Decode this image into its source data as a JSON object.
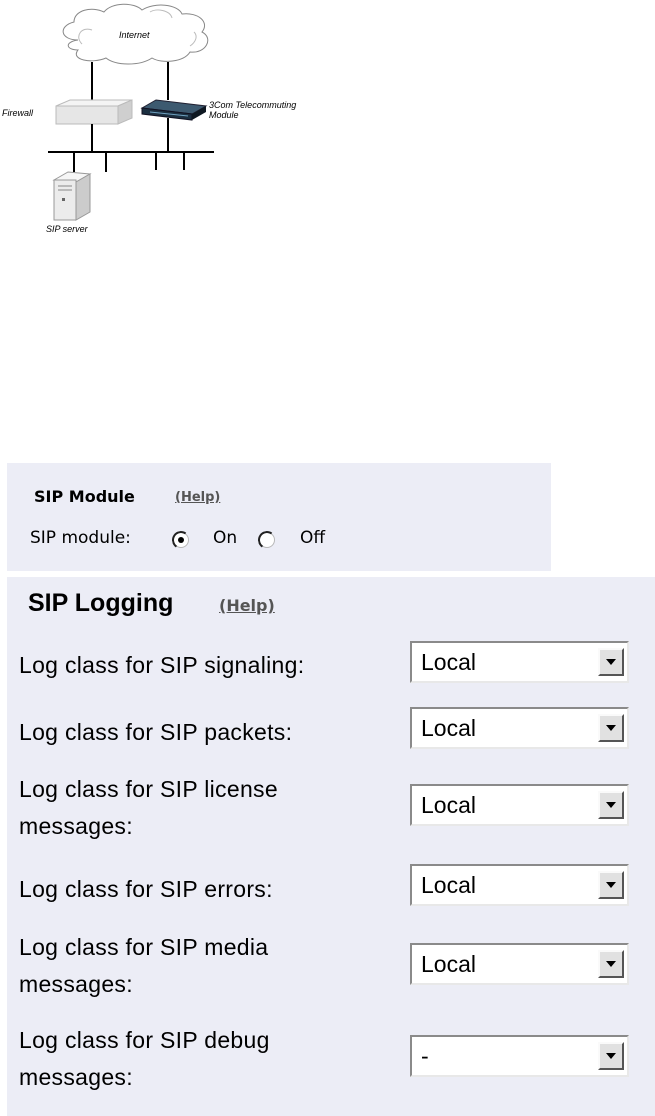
{
  "diagram": {
    "internet_label": "Internet",
    "firewall_label": "Firewall",
    "telecommuting_label": "3Com Telecommuting Module",
    "sip_server_label": "SIP server"
  },
  "sip_module": {
    "title": "SIP Module",
    "help_label": "(Help)",
    "field_label": "SIP module:",
    "options": [
      "On",
      "Off"
    ],
    "selected": "On"
  },
  "sip_logging": {
    "title": "SIP Logging",
    "help_label": "(Help)",
    "rows": [
      {
        "label": "Log class for SIP signaling:",
        "value": "Local"
      },
      {
        "label": "Log class for SIP packets:",
        "value": "Local"
      },
      {
        "label": "Log class for SIP license messages:",
        "value": "Local"
      },
      {
        "label": "Log class for SIP errors:",
        "value": "Local"
      },
      {
        "label": "Log class for SIP media messages:",
        "value": "Local"
      },
      {
        "label": "Log class for SIP debug messages:",
        "value": "-"
      }
    ]
  }
}
